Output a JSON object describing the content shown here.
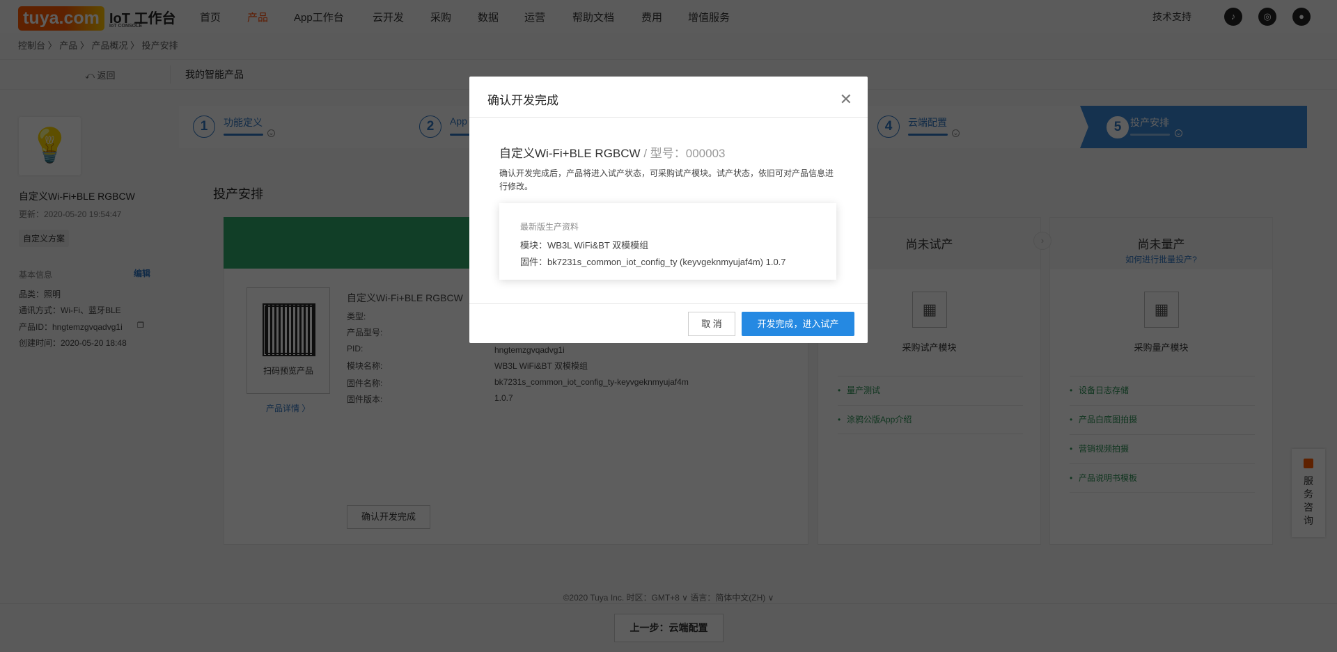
{
  "header": {
    "logo": "tuya.com",
    "brand": "IoT 工作台",
    "brand_sub": "IoT CONSOLE",
    "nav": [
      "首页",
      "产品",
      "App工作台",
      "云开发",
      "采购",
      "数据",
      "运营",
      "帮助文档",
      "费用",
      "增值服务"
    ],
    "support": "技术支持"
  },
  "breadcrumb": "控制台 〉 产品 〉 产品概况 〉 投产安排",
  "subbar": {
    "back": "⤺ 返回",
    "title": "我的智能产品"
  },
  "sidebar": {
    "name": "自定义Wi-Fi+BLE RGBCW",
    "updated": "更新：2020-05-20 19:54:47",
    "tag": "自定义方案",
    "basic_info": "基本信息",
    "edit": "编辑",
    "category": "品类：照明",
    "comm": "通讯方式：Wi-Fi、蓝牙BLE",
    "pid": "产品ID：hngtemzgvqadvg1i",
    "created": "创建时间：2020-05-20 18:48"
  },
  "steps": [
    {
      "n": "1",
      "label": "功能定义"
    },
    {
      "n": "2",
      "label": "App"
    },
    {
      "n": "4",
      "label": "云端配置"
    },
    {
      "n": "5",
      "label": "投产安排"
    }
  ],
  "page_title": "投产安排",
  "product_card": {
    "qr_label": "扫码预览产品",
    "detail_link": "产品详情 〉",
    "name": "自定义Wi-Fi+BLE RGBCW",
    "labels": [
      "类型:",
      "产品型号:",
      "PID:",
      "模块名称:",
      "固件名称:",
      "固件版本:"
    ],
    "values": [
      "",
      "",
      "hngtemzgvqadvg1i",
      "WB3L WiFi&BT 双模模组",
      "bk7231s_common_iot_config_ty-keyvgeknmyujaf4m",
      "1.0.7"
    ],
    "confirm": "确认开发完成"
  },
  "trial": {
    "title": "尚未试产",
    "module": "采购试产模块",
    "items": [
      "量产测试",
      "涂鸦公版App介绍"
    ]
  },
  "mass": {
    "title": "尚未量产",
    "link": "如何进行批量投产?",
    "module": "采购量产模块",
    "items": [
      "设备日志存储",
      "产品白底图拍摄",
      "营销视频拍摄",
      "产品说明书模板"
    ]
  },
  "footer": "©2020 Tuya Inc.    时区：GMT+8 ∨   语言：简体中文(ZH) ∨",
  "prev_button": "上一步：云端配置",
  "service": "服务咨询",
  "modal": {
    "title": "确认开发完成",
    "name": "自定义Wi-Fi+BLE RGBCW",
    "model": " / 型号：000003",
    "desc": "确认开发完成后，产品将进入试产状态，可采购试产模块。试产状态，依旧可对产品信息进行修改。",
    "info_title": "最新版生产资料",
    "module": "模块：WB3L WiFi&BT 双模模组",
    "firmware": "固件：bk7231s_common_iot_config_ty (keyvgeknmyujaf4m) 1.0.7",
    "cancel": "取 消",
    "ok": "开发完成，进入试产"
  }
}
